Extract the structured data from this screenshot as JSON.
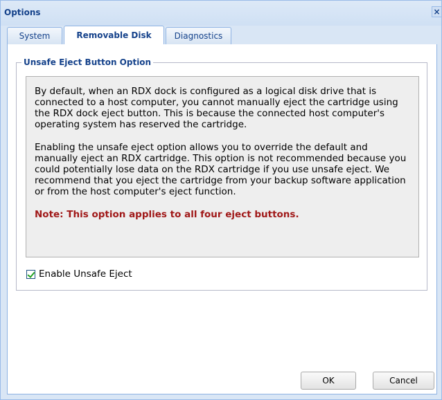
{
  "window": {
    "title": "Options",
    "close_label": "×"
  },
  "tabs": [
    {
      "label": "System",
      "active": false
    },
    {
      "label": "Removable Disk",
      "active": true
    },
    {
      "label": "Diagnostics",
      "active": false
    }
  ],
  "section": {
    "legend": "Unsafe Eject Button Option",
    "paragraph1": "By default, when an RDX dock is configured as a logical disk drive that is connected to a host computer, you cannot manually eject the cartridge using the RDX dock eject button. This is because the connected host computer's operating system has reserved the cartridge.",
    "paragraph2": "Enabling the unsafe eject option allows you to override the default and manually eject an RDX cartridge. This option is not recommended because you could potentially lose data on the RDX cartridge if you use unsafe eject. We recommend that you eject the cartridge from your backup software application or from the host computer's eject function.",
    "note": "Note: This option applies to all four eject buttons.",
    "checkbox": {
      "label": "Enable Unsafe Eject",
      "checked": true
    }
  },
  "buttons": {
    "ok": "OK",
    "cancel": "Cancel"
  }
}
